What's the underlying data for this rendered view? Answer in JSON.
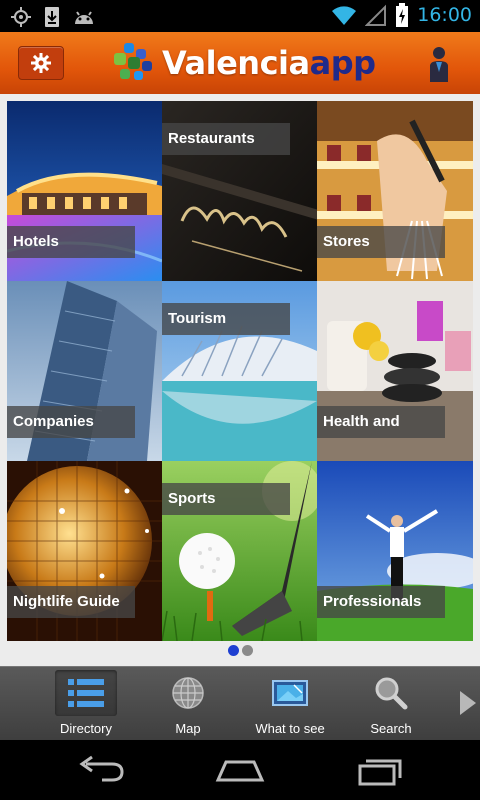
{
  "status_bar": {
    "time": "16:00"
  },
  "app_bar": {
    "logo_part1": "Valencia",
    "logo_part2": "app"
  },
  "tiles": [
    {
      "label": "Hotels",
      "position": "bottom"
    },
    {
      "label": "Restaurants",
      "position": "top"
    },
    {
      "label": "Stores",
      "position": "bottom"
    },
    {
      "label": "Companies",
      "position": "bottom"
    },
    {
      "label": "Tourism",
      "position": "top"
    },
    {
      "label": "Health and",
      "position": "bottom"
    },
    {
      "label": "Nightlife Guide",
      "position": "bottom"
    },
    {
      "label": "Sports",
      "position": "top"
    },
    {
      "label": "Professionals",
      "position": "bottom"
    }
  ],
  "pager": {
    "pages": 2,
    "current": 1,
    "active_color": "#1e3fd1",
    "inactive_color": "#8a8a8a"
  },
  "bottom_nav": {
    "items": [
      {
        "label": "Directory",
        "icon": "list-icon",
        "active": true
      },
      {
        "label": "Map",
        "icon": "globe-icon",
        "active": false
      },
      {
        "label": "What to see",
        "icon": "picture-icon",
        "active": false
      },
      {
        "label": "Search",
        "icon": "search-icon",
        "active": false
      }
    ]
  },
  "colors": {
    "accent": "#e8600f",
    "brand_blue": "#1f2a8a"
  }
}
